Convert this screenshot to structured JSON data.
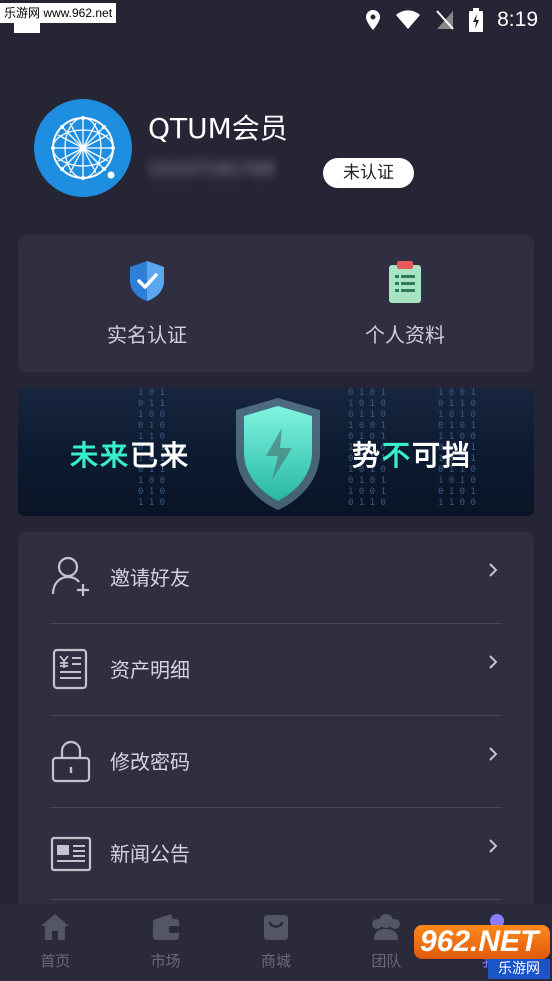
{
  "watermark": {
    "top": "乐游网 www.962.net",
    "bottom_logo": "962.NET",
    "bottom_text": "乐游网"
  },
  "status_bar": {
    "time": "8:19"
  },
  "profile": {
    "name": "QTUM会员",
    "phone": "15337191709",
    "verify_badge": "未认证"
  },
  "quick_actions": [
    {
      "label": "实名认证",
      "icon": "shield-check-icon"
    },
    {
      "label": "个人资料",
      "icon": "clipboard-icon"
    }
  ],
  "banner": {
    "left_accent": "未来",
    "left_rest": "已来",
    "right_rest": "势",
    "right_accent": "不",
    "right_tail": "可挡"
  },
  "menu": [
    {
      "label": "邀请好友",
      "icon": "add-user-icon"
    },
    {
      "label": "资产明细",
      "icon": "ledger-icon"
    },
    {
      "label": "修改密码",
      "icon": "lock-icon"
    },
    {
      "label": "新闻公告",
      "icon": "news-icon"
    }
  ],
  "tabbar": [
    {
      "label": "首页",
      "icon": "home-icon"
    },
    {
      "label": "市场",
      "icon": "wallet-icon"
    },
    {
      "label": "商城",
      "icon": "bag-icon"
    },
    {
      "label": "团队",
      "icon": "team-icon"
    },
    {
      "label": "我的",
      "icon": "user-icon"
    }
  ],
  "colors": {
    "background": "#252535",
    "card": "#2f2f41",
    "accent": "#8a7cff",
    "banner_highlight": "#37f0c8"
  }
}
